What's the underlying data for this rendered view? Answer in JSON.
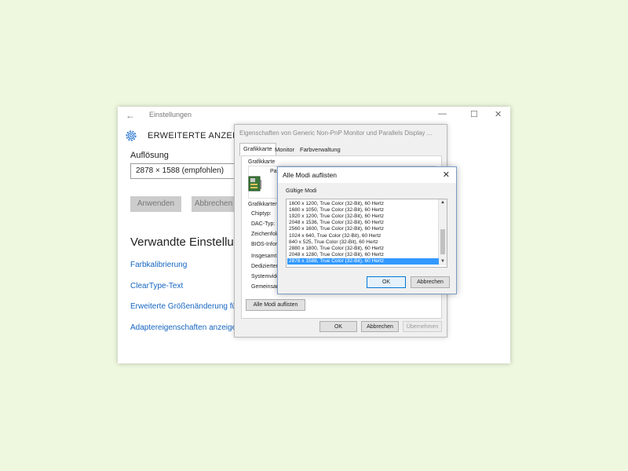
{
  "settings": {
    "window_title": "Einstellungen",
    "heading": "ERWEITERTE ANZEIGEEI",
    "resolution_label": "Auflösung",
    "resolution_value": "2878 × 1588 (empfohlen)",
    "apply_button": "Anwenden",
    "cancel_button": "Abbrechen",
    "related_heading": "Verwandte Einstellu",
    "links": [
      "Farbkalibrierung",
      "ClearType-Text",
      "Erweiterte Größenänderung fü",
      "Adaptereigenschaften anzeige"
    ],
    "window_controls": {
      "minimize": "—",
      "maximize": "☐",
      "close": "✕"
    }
  },
  "properties": {
    "title": "Eigenschaften von Generic Non-PnP Monitor und Parallels Display ...",
    "tabs": [
      "Grafikkarte",
      "Monitor",
      "Farbverwaltung"
    ],
    "adapter_group": "Grafikkarte",
    "adapter_name": "Pa",
    "info_group": "Grafikkarteni",
    "info_labels": [
      "Chiptyp:",
      "DAC-Typ:",
      "Zeichenfolg",
      "BIOS-Inform",
      "Insgesamt v",
      "Dedizierter",
      "Systemvide",
      "Gemeinsam"
    ],
    "list_all_button": "Alle Modi auflisten",
    "ok_button": "OK",
    "cancel_button": "Abbrechen",
    "apply_button": "Übernehmen"
  },
  "modes_dialog": {
    "title": "Alle Modi auflisten",
    "close": "✕",
    "group_label": "Gültige Modi",
    "modes": [
      "1600 x 1200, True Color (32-Bit), 60 Hertz",
      "1680 x 1050, True Color (32-Bit), 60 Hertz",
      "1920 x 1200, True Color (32-Bit), 60 Hertz",
      "2048 x 1536, True Color (32-Bit), 60 Hertz",
      "2560 x 1600, True Color (32-Bit), 60 Hertz",
      "1024 x 640, True Color (32-Bit), 60 Hertz",
      "840 x 525, True Color (32-Bit), 60 Hertz",
      "2880 x 1800, True Color (32-Bit), 60 Hertz",
      "2048 x 1280, True Color (32-Bit), 60 Hertz",
      "2878 x 1588, True Color (32-Bit), 60 Hertz"
    ],
    "selected_index": 9,
    "ok_button": "OK",
    "cancel_button": "Abbrechen"
  },
  "colors": {
    "accent": "#1565c0",
    "selection": "#3399ff",
    "page_background": "#eef8df"
  }
}
